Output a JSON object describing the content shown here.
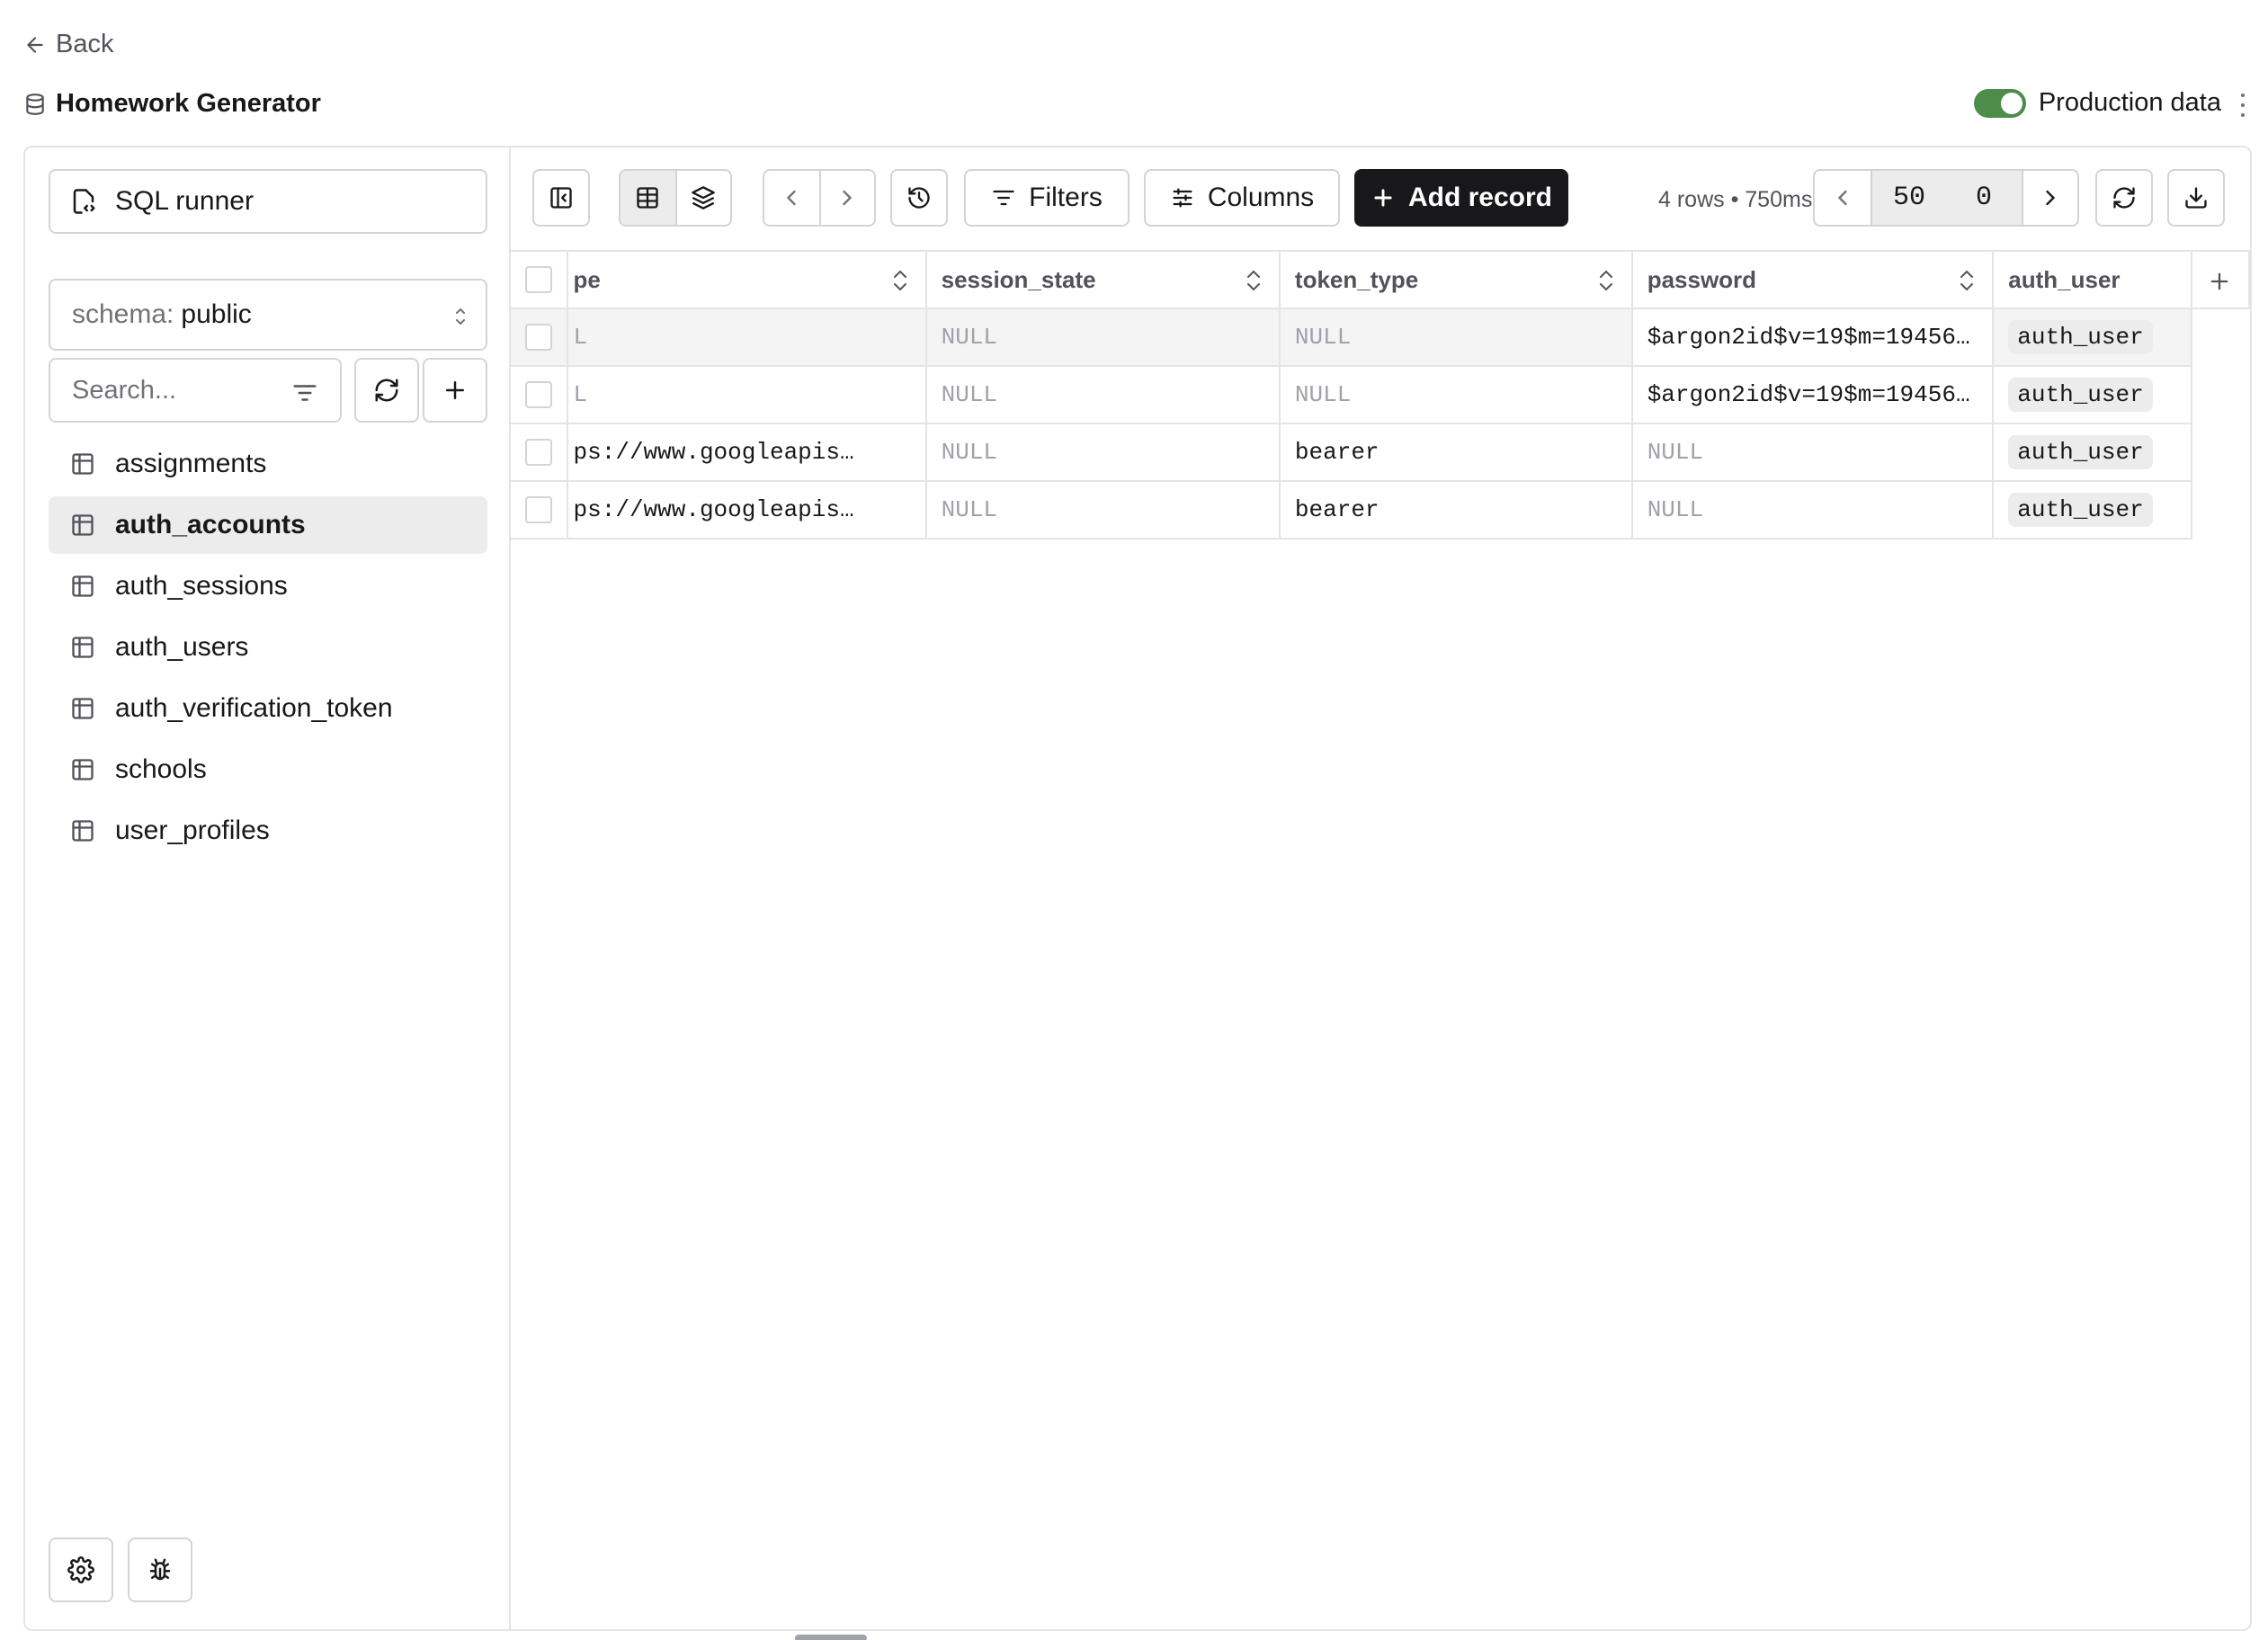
{
  "nav": {
    "back_label": "Back"
  },
  "database": {
    "name": "Homework Generator"
  },
  "production": {
    "label": "Production data",
    "enabled": true
  },
  "sidebar": {
    "sql_runner_label": "SQL runner",
    "schema": {
      "prefix": "schema:",
      "value": "public"
    },
    "search_placeholder": "Search...",
    "tables": [
      {
        "label": "assignments",
        "active": false
      },
      {
        "label": "auth_accounts",
        "active": true
      },
      {
        "label": "auth_sessions",
        "active": false
      },
      {
        "label": "auth_users",
        "active": false
      },
      {
        "label": "auth_verification_token",
        "active": false
      },
      {
        "label": "schools",
        "active": false
      },
      {
        "label": "user_profiles",
        "active": false
      }
    ]
  },
  "toolbar": {
    "filters_label": "Filters",
    "columns_label": "Columns",
    "add_record_label": "Add record",
    "row_info": "4 rows • 750ms",
    "limit": "50",
    "offset": "0"
  },
  "grid": {
    "columns": [
      "pe",
      "session_state",
      "token_type",
      "password",
      "auth_user"
    ],
    "rows": [
      {
        "c0": "L",
        "c1": "NULL",
        "c2": "NULL",
        "c3": "$argon2id$v=19$m=19456…",
        "c4": "auth_user"
      },
      {
        "c0": "L",
        "c1": "NULL",
        "c2": "NULL",
        "c3": "$argon2id$v=19$m=19456…",
        "c4": "auth_user"
      },
      {
        "c0": "ps://www.googleapis…",
        "c1": "NULL",
        "c2": "bearer",
        "c3": "NULL",
        "c4": "auth_user"
      },
      {
        "c0": "ps://www.googleapis…",
        "c1": "NULL",
        "c2": "bearer",
        "c3": "NULL",
        "c4": "auth_user"
      }
    ]
  },
  "colors": {
    "accent": "#18181b",
    "toggle_on": "#4d8c4a",
    "border": "#e4e4e7"
  }
}
